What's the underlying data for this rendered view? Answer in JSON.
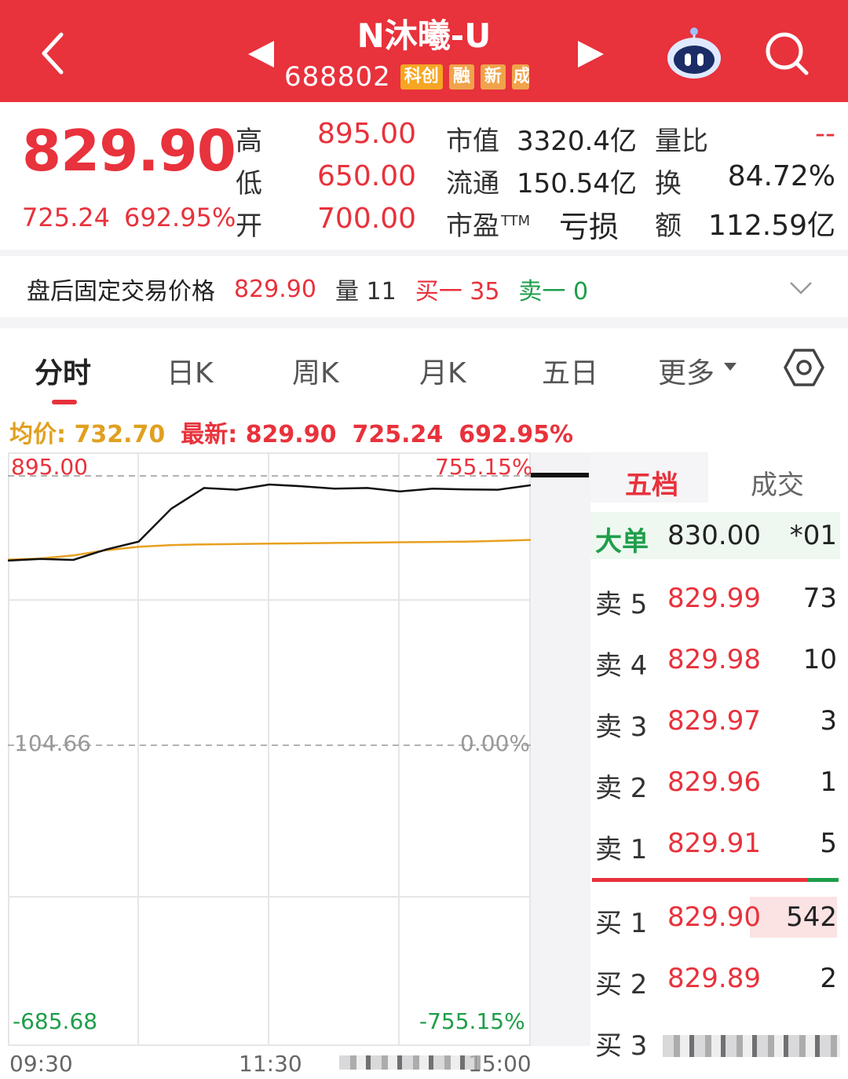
{
  "header": {
    "title": "N沐曦-U",
    "code": "688802",
    "tags": [
      "科创",
      "融",
      "新",
      "成"
    ]
  },
  "quote": {
    "price": "829.90",
    "change": "725.24",
    "change_pct": "692.95%",
    "high_label": "高",
    "high": "895.00",
    "low_label": "低",
    "low": "650.00",
    "open_label": "开",
    "open": "700.00",
    "mktcap_label": "市值",
    "mktcap": "3320.4亿",
    "float_label": "流通",
    "float": "150.54亿",
    "pe_label": "市盈",
    "pe_sup": "TTM",
    "pe": "亏损",
    "vol_ratio_label": "量比",
    "vol_ratio": "--",
    "turnover_label": "换",
    "turnover": "84.72%",
    "amount_label": "额",
    "amount": "112.59亿"
  },
  "after_hours": {
    "label": "盘后固定交易价格",
    "price": "829.90",
    "volume": "量 11",
    "buy1": "买一 35",
    "sell1": "卖一 0"
  },
  "tabs": [
    "分时",
    "日K",
    "周K",
    "月K",
    "五日",
    "更多"
  ],
  "intraday": {
    "avg_label": "均价:",
    "avg": "732.70",
    "latest_label": "最新:",
    "latest": "829.90",
    "change": "725.24",
    "change_pct": "692.95%",
    "y_top": "895.00",
    "y_top_pct": "755.15%",
    "y_mid": "104.66",
    "y_mid_pct": "0.00%",
    "y_bottom": "-685.68",
    "y_bottom_pct": "-755.15%",
    "x_labels": [
      "09:30",
      "11:30",
      "15:00"
    ]
  },
  "chart_data": {
    "type": "line",
    "x": [
      "09:30",
      "09:45",
      "10:00",
      "10:15",
      "10:30",
      "10:45",
      "11:00",
      "11:15",
      "11:30",
      "13:15",
      "13:30",
      "13:45",
      "14:00",
      "14:15",
      "14:30",
      "14:45",
      "15:00"
    ],
    "series": [
      {
        "name": "最新",
        "values": [
          650,
          655,
          652,
          682,
          705,
          800,
          860,
          855,
          870,
          865,
          858,
          860,
          850,
          858,
          856,
          855,
          868
        ]
      },
      {
        "name": "均价",
        "values": [
          653,
          656,
          665,
          680,
          690,
          695,
          697,
          698,
          699,
          700,
          701,
          702,
          703,
          704,
          705,
          707,
          710
        ]
      }
    ],
    "ylim": [
      -685.68,
      895.0
    ],
    "baseline": 104.66
  },
  "orderbook": {
    "tab_active": "五档",
    "tab_inactive": "成交",
    "big_order": {
      "label": "大单",
      "price": "830.00",
      "volume": "*01"
    },
    "asks": [
      {
        "label": "卖 5",
        "price": "829.99",
        "volume": "73"
      },
      {
        "label": "卖 4",
        "price": "829.98",
        "volume": "10"
      },
      {
        "label": "卖 3",
        "price": "829.97",
        "volume": "3"
      },
      {
        "label": "卖 2",
        "price": "829.96",
        "volume": "1"
      },
      {
        "label": "卖 1",
        "price": "829.91",
        "volume": "5"
      }
    ],
    "bids": [
      {
        "label": "买 1",
        "price": "829.90",
        "volume": "542",
        "bar": 0.35
      },
      {
        "label": "买 2",
        "price": "829.89",
        "volume": "2"
      },
      {
        "label": "买 3",
        "price": "",
        "volume": ""
      }
    ]
  },
  "colors": {
    "up": "#e8323c",
    "down": "#1e9e4a",
    "avg_line": "#e8a020",
    "price_line": "#111111"
  }
}
